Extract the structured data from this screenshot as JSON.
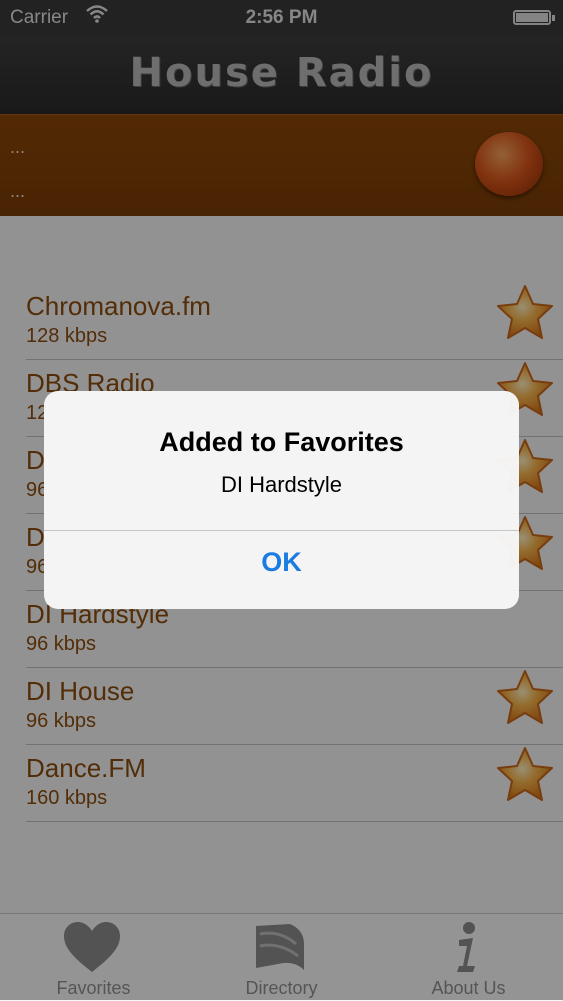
{
  "status_bar": {
    "carrier": "Carrier",
    "time": "2:56 PM"
  },
  "app": {
    "title": "House Radio"
  },
  "now_playing": {
    "line1": "...",
    "line2": "..."
  },
  "stations": [
    {
      "name": "Chromanova.fm",
      "bitrate": "128 kbps",
      "favorite": true
    },
    {
      "name": "DBS Radio",
      "bitrate": "12",
      "favorite": true
    },
    {
      "name": "D",
      "bitrate": "96",
      "favorite": true
    },
    {
      "name": "D",
      "bitrate": "96",
      "favorite": true
    },
    {
      "name": "DI Hardstyle",
      "bitrate": "96 kbps",
      "favorite": false
    },
    {
      "name": "DI House",
      "bitrate": "96 kbps",
      "favorite": true
    },
    {
      "name": "Dance.FM",
      "bitrate": "160 kbps",
      "favorite": true
    }
  ],
  "tabs": [
    {
      "label": "Favorites",
      "icon": "heart-icon"
    },
    {
      "label": "Directory",
      "icon": "directory-icon"
    },
    {
      "label": "About Us",
      "icon": "info-icon"
    }
  ],
  "alert": {
    "title": "Added to Favorites",
    "message": "DI Hardstyle",
    "ok_label": "OK"
  },
  "colors": {
    "accent": "#7a3c05",
    "station_text": "#8a4b0d",
    "alert_button": "#1a7be0"
  }
}
